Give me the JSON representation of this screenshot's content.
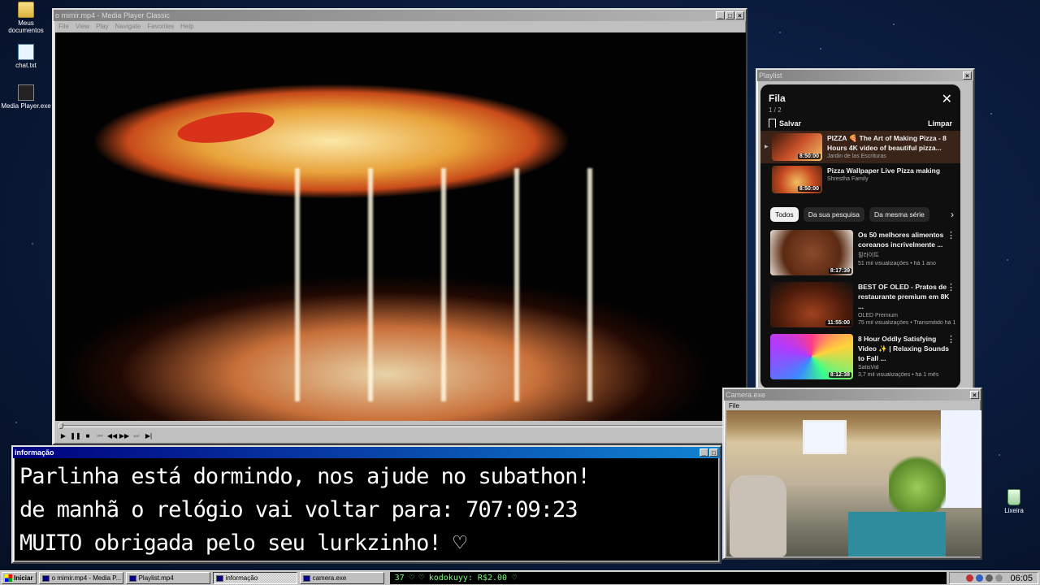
{
  "desktop": {
    "icons": [
      {
        "label": "Meus documentos"
      },
      {
        "label": "chat.txt"
      },
      {
        "label": "Media Player.exe"
      },
      {
        "label": "Lixeira"
      }
    ]
  },
  "mpc": {
    "title": "o mimir.mp4 - Media Player Classic",
    "menu": [
      "File",
      "View",
      "Play",
      "Navigate",
      "Favorites",
      "Help"
    ],
    "playing": "paused",
    "progress": 0.0
  },
  "playlist_window": {
    "title": "Playlist",
    "panel_title": "Fila",
    "count": "1 / 2",
    "save_label": "Salvar",
    "clear_label": "Limpar",
    "queue": [
      {
        "title": "PIZZA 🍕 The Art of Making Pizza - 8 Hours 4K video of beautiful pizza...",
        "channel": "Jardin de las Escrituras",
        "duration": "8:50:00",
        "current": true
      },
      {
        "title": "Pizza Wallpaper Live Pizza making",
        "channel": "Shrestha Family",
        "duration": "8:50:00",
        "current": false
      }
    ],
    "chips": [
      "Todos",
      "Da sua pesquisa",
      "Da mesma série"
    ],
    "recommendations": [
      {
        "title": "Os 50 melhores alimentos coreanos incrivelmente ...",
        "channel": "필라이트",
        "meta": "51 mil visualizações • há 1 ano",
        "duration": "8:17:39"
      },
      {
        "title": "BEST OF OLED - Pratos de restaurante premium em 8K ...",
        "channel": "OLED Premium",
        "meta": "75 mil visualizações • Transmitido há 1 ...",
        "duration": "11:55:00"
      },
      {
        "title": "8 Hour Oddly Satisfying Video ✨ | Relaxing Sounds to Fall ...",
        "channel": "SatisVid",
        "meta": "3,7 mil visualizações • há 1 mês",
        "duration": "8:12:38"
      }
    ]
  },
  "info_window": {
    "title": "informação",
    "lines": [
      "Parlinha está dormindo, nos ajude no subathon!",
      "de manhã o relógio vai voltar para:  707:09:23",
      "MUITO obrigada pelo seu lurkzinho! ♡"
    ]
  },
  "camera_window": {
    "title": "Camera.exe",
    "menu": [
      "File"
    ]
  },
  "taskbar": {
    "start_label": "Iniciar",
    "tasks": [
      {
        "label": "o mimir.mp4 - Media P...",
        "active": false
      },
      {
        "label": "Playlist.mp4",
        "active": false
      },
      {
        "label": "informação",
        "active": true
      },
      {
        "label": "camera.exe",
        "active": false
      }
    ],
    "ticker": "37 ♡   ♡ kodokuyy: R$2.00 ♡",
    "clock": "06:05"
  },
  "colors": {
    "title_active": "#000080",
    "title_inactive": "#808080",
    "youtube_bg": "#0f0f0f",
    "ticker_green": "#7cfc7c"
  }
}
